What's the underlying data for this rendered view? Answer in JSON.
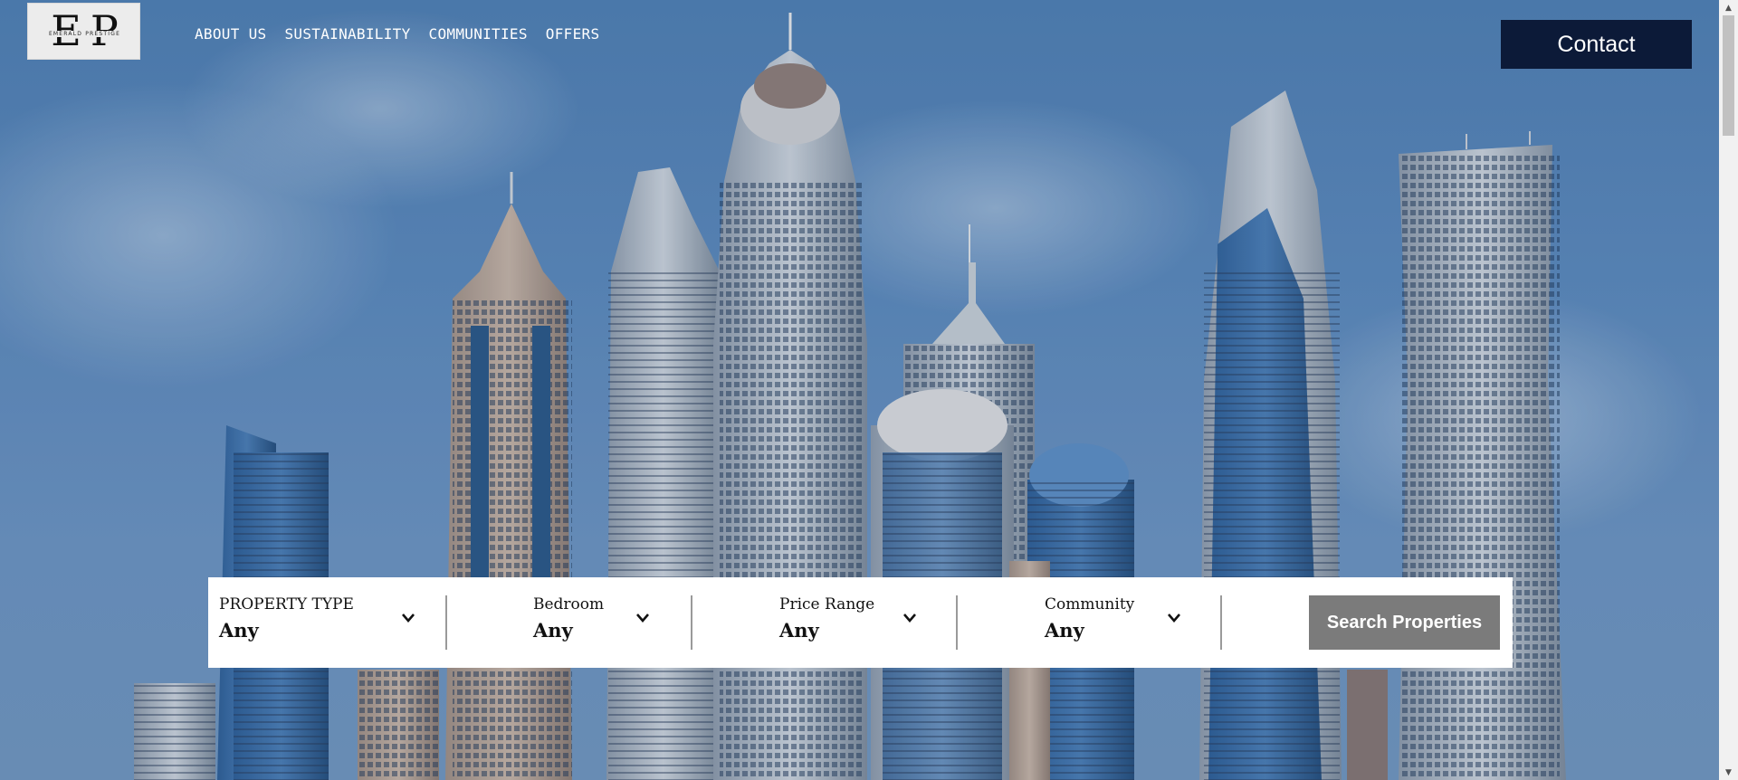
{
  "logo": {
    "letters": "EP",
    "words": "EMERALD PRESTIGE"
  },
  "nav": {
    "items": [
      {
        "label": "ABOUT US"
      },
      {
        "label": "SUSTAINABILITY"
      },
      {
        "label": "COMMUNITIES"
      },
      {
        "label": "OFFERS"
      }
    ]
  },
  "header": {
    "contact_label": "Contact"
  },
  "search": {
    "filters": [
      {
        "label": "PROPERTY TYPE",
        "value": "Any",
        "icon": "chevron-down-icon"
      },
      {
        "label": "Bedroom",
        "value": "Any",
        "icon": "chevron-down-icon"
      },
      {
        "label": "Price Range",
        "value": "Any",
        "icon": "chevron-down-icon"
      },
      {
        "label": "Community",
        "value": "Any",
        "icon": "chevron-down-icon"
      }
    ],
    "button_label": "Search Properties"
  },
  "colors": {
    "contact_bg": "#0c1a38",
    "search_button_bg": "#7b7b7b",
    "sky": "#5a88bb"
  },
  "hero": {
    "image": "Dubai Marina skyscrapers against blue sky"
  }
}
